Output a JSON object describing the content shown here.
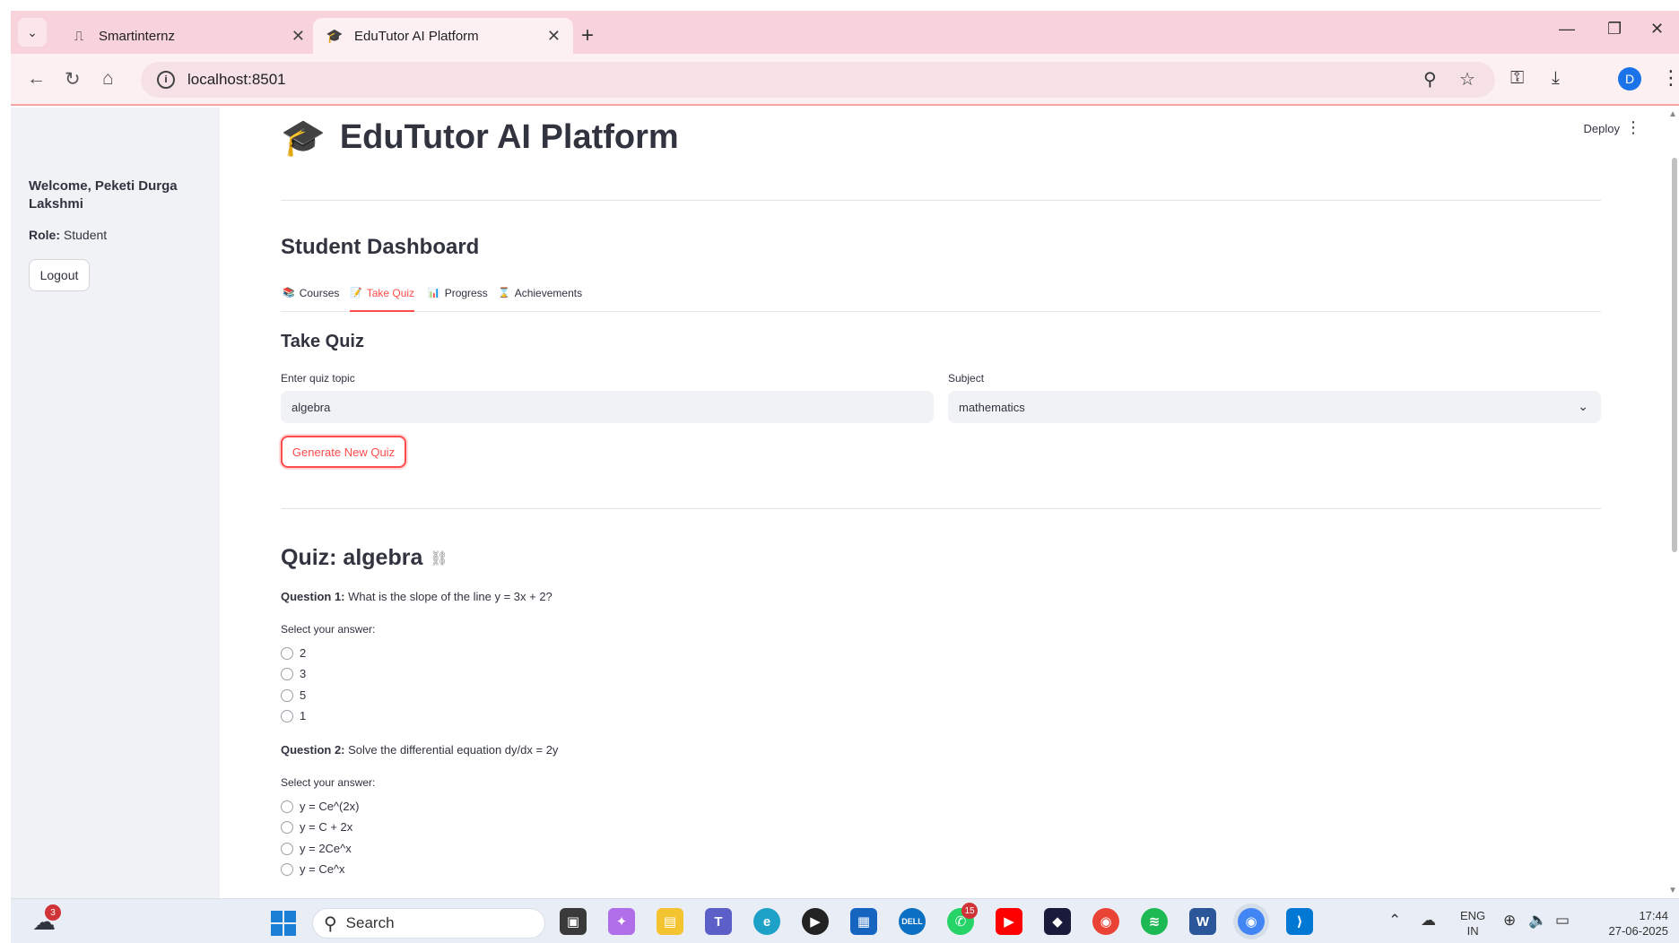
{
  "browser": {
    "tabs": [
      {
        "title": "Smartinternz",
        "active": false
      },
      {
        "title": "EduTutor AI Platform",
        "active": true
      }
    ],
    "url": "localhost:8501",
    "profile_initial": "D"
  },
  "sidebar": {
    "welcome": "Welcome, Peketi Durga Lakshmi",
    "role_label": "Role:",
    "role_value": "Student",
    "logout_label": "Logout"
  },
  "header": {
    "deploy_label": "Deploy"
  },
  "app": {
    "title": "EduTutor AI Platform",
    "dashboard_title": "Student Dashboard",
    "tabs": [
      {
        "label": "Courses",
        "icon": "books-icon",
        "active": false
      },
      {
        "label": "Take Quiz",
        "icon": "memo-icon",
        "active": true
      },
      {
        "label": "Progress",
        "icon": "bar-chart-icon",
        "active": false
      },
      {
        "label": "Achievements",
        "icon": "hourglass-icon",
        "active": false
      }
    ]
  },
  "take_quiz": {
    "title": "Take Quiz",
    "topic_label": "Enter quiz topic",
    "topic_value": "algebra",
    "subject_label": "Subject",
    "subject_value": "mathematics",
    "generate_label": "Generate New Quiz"
  },
  "quiz": {
    "title": "Quiz: algebra",
    "select_hint": "Select your answer:",
    "questions": [
      {
        "number_label": "Question 1:",
        "text": "What is the slope of the line y = 3x + 2?",
        "options": [
          "2",
          "3",
          "5",
          "1"
        ]
      },
      {
        "number_label": "Question 2:",
        "text": "Solve the differential equation dy/dx = 2y",
        "options": [
          "y = Ce^(2x)",
          "y = C + 2x",
          "y = 2Ce^x",
          "y = Ce^x"
        ]
      }
    ]
  },
  "taskbar": {
    "weather_badge": "3",
    "search_placeholder": "Search",
    "whatsapp_badge": "15",
    "lang_line1": "ENG",
    "lang_line2": "IN",
    "time": "17:44",
    "date": "27-06-2025"
  }
}
